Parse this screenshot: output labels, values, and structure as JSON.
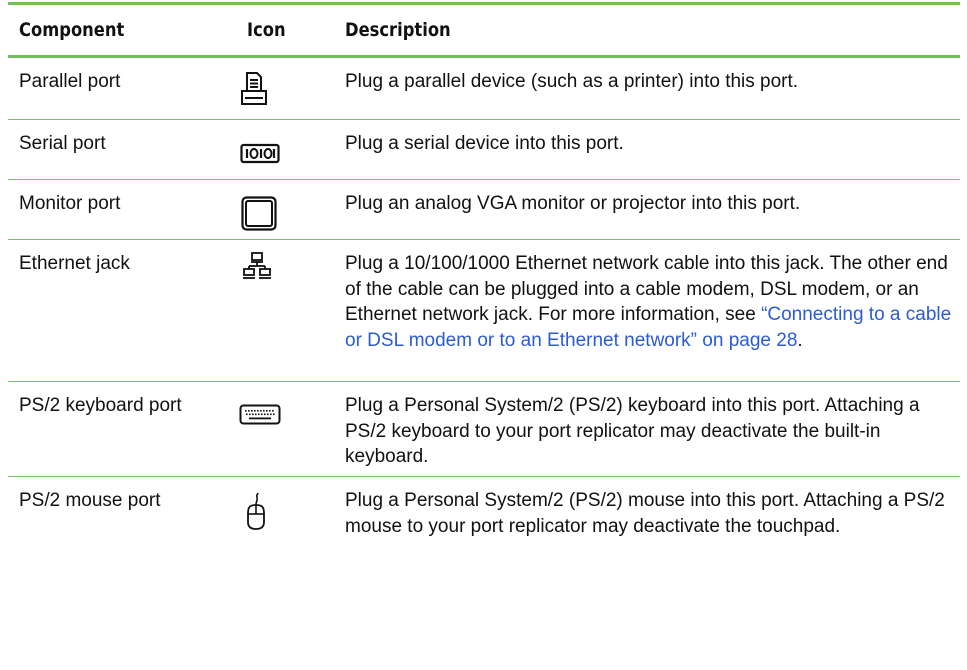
{
  "table": {
    "headers": {
      "component": "Component",
      "icon": "Icon",
      "description": "Description"
    },
    "rows": [
      {
        "component": "Parallel port",
        "icon": "parallel-printer-icon",
        "description": "Plug a parallel device (such as a printer) into this port."
      },
      {
        "component": "Serial port",
        "icon": "serial-port-icon",
        "description": "Plug a serial device into this port."
      },
      {
        "component": "Monitor port",
        "icon": "monitor-icon",
        "description": "Plug an analog VGA monitor or projector into this port."
      },
      {
        "component": "Ethernet jack",
        "icon": "network-icon",
        "description": "Plug a 10/100/1000 Ethernet network cable into this jack. The other end of the cable can be plugged into a cable modem, DSL modem, or an Ethernet network jack. For more information, see ",
        "link": "“Connecting to a cable or DSL modem or to an Ethernet network” on page 28",
        "description_end": "."
      },
      {
        "component": "PS/2 keyboard port",
        "icon": "keyboard-icon",
        "description": "Plug a Personal System/2 (PS/2) keyboard into this port. Attaching a PS/2 keyboard to your port replicator may deactivate the built-in keyboard."
      },
      {
        "component": "PS/2 mouse port",
        "icon": "mouse-icon",
        "description": "Plug a Personal System/2 (PS/2) mouse into this port. Attaching a PS/2 mouse to your port replicator may deactivate the touchpad."
      }
    ]
  },
  "colors": {
    "rule": "#6fbf5a",
    "link": "#2a5bd7"
  }
}
